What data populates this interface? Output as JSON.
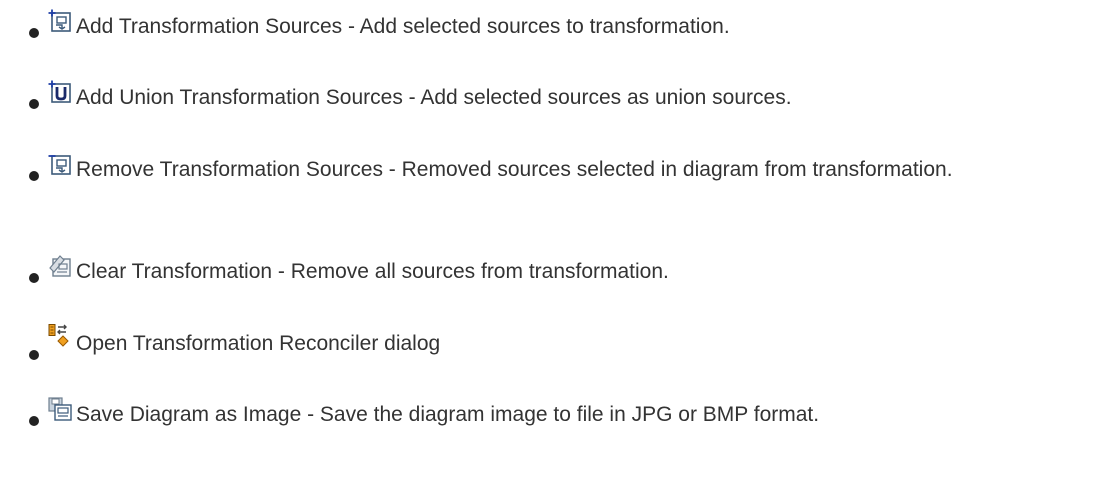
{
  "items": [
    {
      "icon": "add-sources-icon",
      "text": "Add Transformation Sources - Add selected sources to transformation."
    },
    {
      "icon": "add-union-sources-icon",
      "text": "Add Union Transformation Sources - Add selected sources as union sources."
    },
    {
      "icon": "remove-sources-icon",
      "text": "Remove Transformation Sources - Removed sources selected in diagram from transformation."
    },
    {
      "icon": "clear-transformation-icon",
      "text": "Clear Transformation - Remove all sources from transformation."
    },
    {
      "icon": "reconciler-icon",
      "text": "Open Transformation Reconciler dialog"
    },
    {
      "icon": "save-image-icon",
      "text": "Save Diagram as Image - Save the diagram image to file in JPG or BMP format."
    }
  ],
  "colors": {
    "text": "#333333",
    "bullet": "#222222",
    "icon_blue": "#1f3fa6",
    "icon_gray": "#6f7f8f",
    "icon_orange": "#f0a020"
  }
}
